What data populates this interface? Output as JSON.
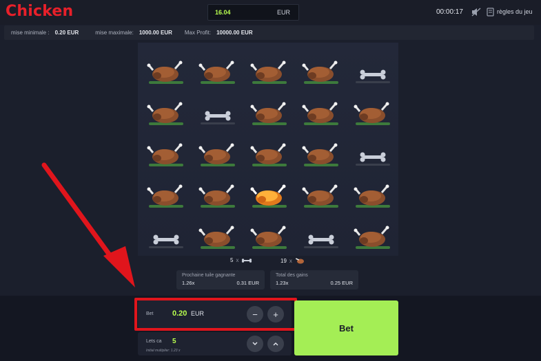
{
  "app": {
    "title": "Chicken",
    "balance": "16.04",
    "balance_currency": "EUR",
    "timer": "00:00:17",
    "rules_label": "règles du jeu",
    "colors": {
      "logo": "#e8202a",
      "accent": "#b8ff4f",
      "bet_button": "#a4ee55",
      "highlight": "#e0151c"
    }
  },
  "limits": {
    "min_label": "mise minimale :",
    "min_value": "0.20 EUR",
    "max_label": "mise maximale:",
    "max_value": "1000.00 EUR",
    "profit_label": "Max Profit:",
    "profit_value": "10000.00 EUR"
  },
  "board": {
    "grid": [
      [
        "chicken",
        "chicken",
        "chicken",
        "chicken",
        "bone"
      ],
      [
        "chicken",
        "bone",
        "chicken",
        "chicken",
        "chicken"
      ],
      [
        "chicken",
        "chicken",
        "chicken",
        "chicken",
        "bone"
      ],
      [
        "chicken",
        "chicken",
        "golden-chicken",
        "chicken",
        "chicken"
      ],
      [
        "bone",
        "chicken",
        "chicken",
        "bone",
        "chicken"
      ]
    ]
  },
  "stats": {
    "bones_count": "5",
    "chickens_count": "19",
    "times": "x",
    "next_label": "Prochaine tuile gagnante",
    "next_multiplier": "1.26x",
    "next_amount": "0.31 EUR",
    "total_label": "Total des gains",
    "total_multiplier": "1.23x",
    "total_amount": "0.25 EUR"
  },
  "controls": {
    "bet_label": "Bet",
    "bet_value": "0.20",
    "bet_currency": "EUR",
    "minus": "−",
    "plus": "+",
    "lets_label": "Lets ca",
    "lets_value": "5",
    "lets_hint": "Initial multiplier: 1.23 x",
    "bet_button": "Bet"
  }
}
